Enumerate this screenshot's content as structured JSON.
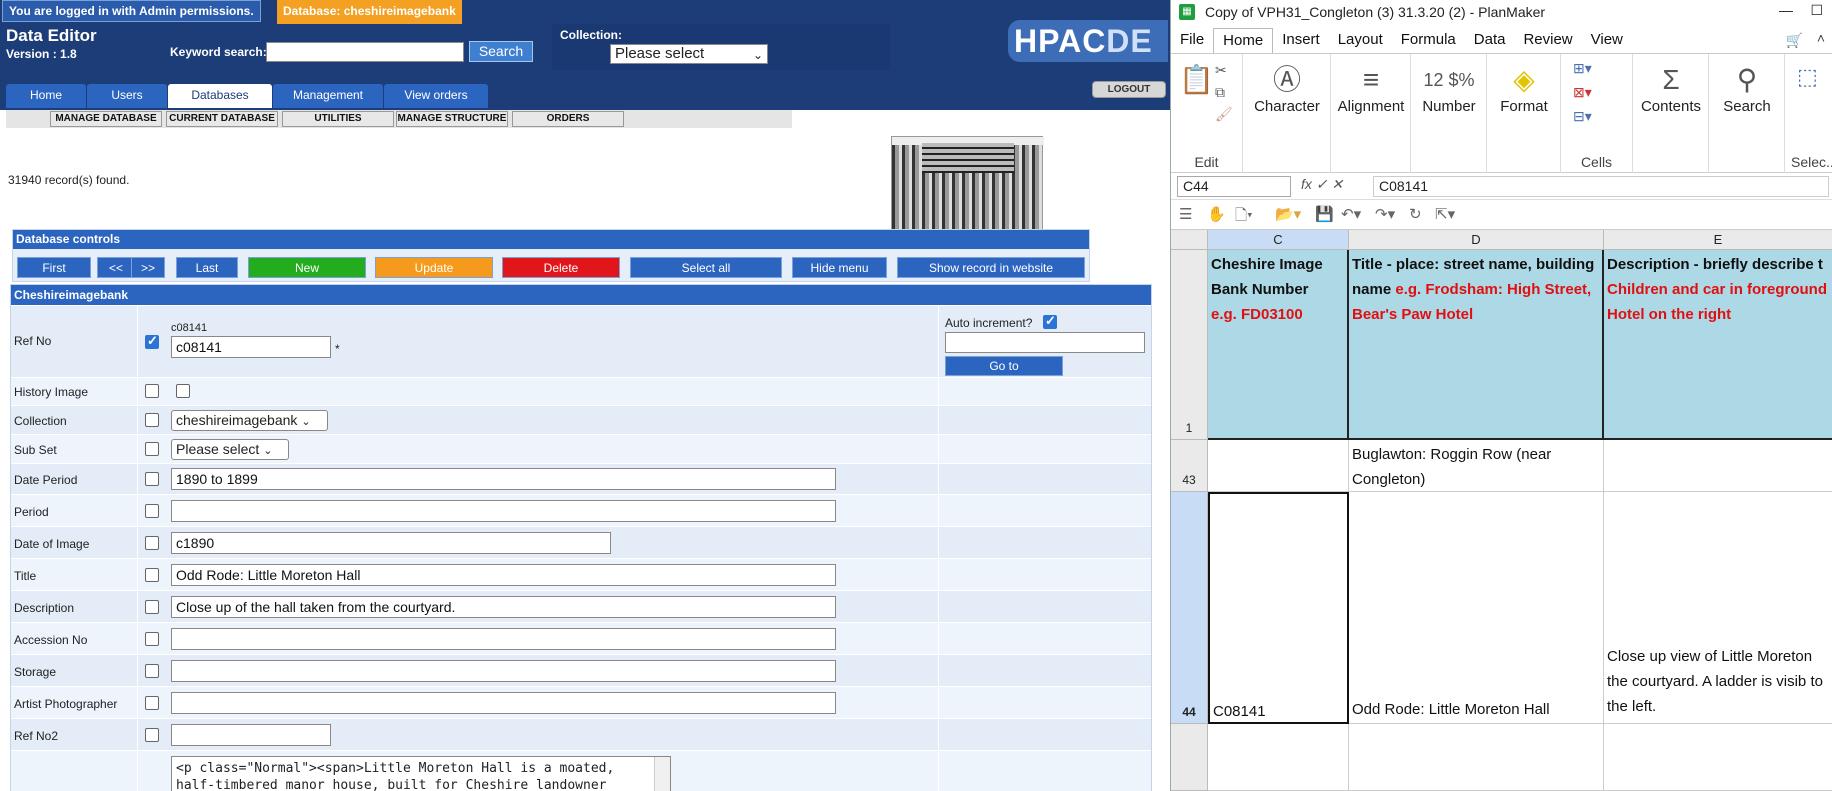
{
  "web": {
    "login_message": "You are logged in with Admin permissions.",
    "database_badge": "Database: cheshireimagebank",
    "app_title": "Data Editor",
    "version": "Version : 1.8",
    "keyword_label": "Keyword search:",
    "keyword_value": "",
    "search_button": "Search",
    "collection_label": "Collection:",
    "collection_value": "Please select",
    "logo": "HPAC",
    "logo_suffix": "DE",
    "logout": "LOGOUT",
    "tabs": [
      "Home",
      "Users",
      "Databases",
      "Management",
      "View orders"
    ],
    "active_tab": "Databases",
    "submenus": [
      "MANAGE DATABASE",
      "CURRENT DATABASE",
      "UTILITIES",
      "MANAGE STRUCTURE",
      "ORDERS"
    ],
    "records_found": "31940 record(s) found.",
    "db_controls_title": "Database controls",
    "controls": [
      "First",
      "<<",
      ">>",
      "Last",
      "New",
      "Update",
      "Delete",
      "Select all",
      "Hide menu",
      "Show record in website"
    ],
    "form_title": "Cheshireimagebank",
    "fields": [
      {
        "label": "Ref No",
        "checked": true,
        "caption": "c08141",
        "value": "c08141",
        "suffix": "*"
      },
      {
        "label": "History Image",
        "checked": false,
        "value": ""
      },
      {
        "label": "Collection",
        "checked": false,
        "value": "cheshireimagebank"
      },
      {
        "label": "Sub Set",
        "checked": false,
        "value": "Please select"
      },
      {
        "label": "Date Period",
        "checked": false,
        "value": "1890 to 1899"
      },
      {
        "label": "Period",
        "checked": false,
        "value": ""
      },
      {
        "label": "Date of Image",
        "checked": false,
        "value": "c1890"
      },
      {
        "label": "Title",
        "checked": false,
        "value": "Odd Rode: Little Moreton Hall"
      },
      {
        "label": "Description",
        "checked": false,
        "value": "Close up of the hall taken from the courtyard."
      },
      {
        "label": "Accession No",
        "checked": false,
        "value": ""
      },
      {
        "label": "Storage",
        "checked": false,
        "value": ""
      },
      {
        "label": "Artist Photographer",
        "checked": false,
        "value": ""
      },
      {
        "label": "Ref No2",
        "checked": false,
        "value": ""
      }
    ],
    "auto_increment_label": "Auto increment?",
    "auto_increment_checked": true,
    "goto_value": "",
    "goto_button": "Go to",
    "html_editor_value": "<p class=\"Normal\"><span>Little Moreton Hall is a moated,\nhalf-timbered manor house, built for Cheshire landowner"
  },
  "planmaker": {
    "title": "Copy of VPH31_Congleton (3) 31.3.20 (2) - PlanMaker",
    "menus": [
      "File",
      "Home",
      "Insert",
      "Layout",
      "Formula",
      "Data",
      "Review",
      "View"
    ],
    "active_menu": "Home",
    "ribbon": {
      "edit_label": "Edit",
      "character": "Character",
      "alignment": "Alignment",
      "number": "Number",
      "format": "Format",
      "cells_label": "Cells",
      "contents": "Contents",
      "search": "Search",
      "selection_label": "Selec..."
    },
    "namebox": "C44",
    "formula_value": "C08141",
    "columns": [
      "C",
      "D",
      "E"
    ],
    "header_row_num": "1",
    "header_cells": {
      "c_bold": "Cheshire Image Bank Number",
      "c_red": "e.g. FD03100",
      "d_bold": "Title  - place: street name, building name",
      "d_red": "e.g. Frodsham: High Street, Bear's Paw Hotel",
      "e_bold": "Description - briefly describe t",
      "e_red": "Children and car in foreground Hotel on the right"
    },
    "rows": [
      {
        "num": "43",
        "c": "",
        "d": "Buglawton: Roggin Row (near Congleton)",
        "e": ""
      },
      {
        "num": "44",
        "c": "C08141",
        "d": "Odd Rode: Little Moreton Hall",
        "e": "Close up view of Little Moreton the courtyard. A ladder is visib to the left."
      }
    ]
  }
}
